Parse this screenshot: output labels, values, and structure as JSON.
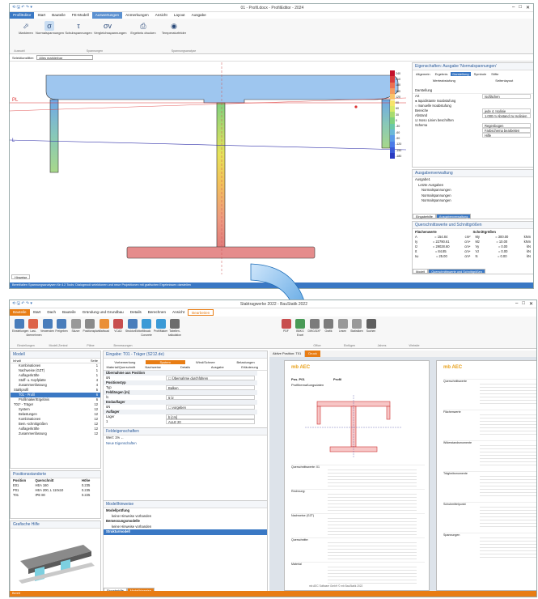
{
  "top": {
    "title": "01 - Profil.docx - ProfilEditor - 2024",
    "win": [
      "–",
      "□",
      "✕"
    ],
    "tabs": [
      "ProfilEditor",
      "Start",
      "Bauteile",
      "FE-Modell",
      "Auswertungen",
      "Anmerkungen",
      "Ansicht",
      "Layout",
      "Ausgabe"
    ],
    "active_tab": 4,
    "ribbon_buttons": [
      {
        "label": "Markieren",
        "icon": "cursor-icon",
        "glyph": "⬀"
      },
      {
        "label": "Normalspannungen",
        "icon": "sigma-icon",
        "glyph": "σ"
      },
      {
        "label": "Schubspannungen",
        "icon": "tau-icon",
        "glyph": "τ"
      },
      {
        "label": "Vergleichsspannungen",
        "icon": "sigma-v-icon",
        "glyph": "σv"
      },
      {
        "label": "Ergebnis drucken",
        "icon": "printer-icon",
        "glyph": "⎙"
      },
      {
        "label": "Temperaturfelder",
        "icon": "thermometer-icon",
        "glyph": "◉"
      }
    ],
    "groups": [
      "Auswahl",
      "Spannungen",
      "Spannungsanalyse"
    ],
    "filter_label": "Selektionsfilter:",
    "filter_value": "Alles markierbar",
    "labels": {
      "pl": "PL",
      "l": "L"
    },
    "legend": [
      "240",
      "210",
      "180",
      "150",
      "120",
      "90",
      "60",
      "30",
      "0",
      "-30",
      "-60",
      "-90",
      "-120",
      "-150",
      "-180"
    ],
    "bottom_tab": "Hinweise",
    "status": "Bereit/allen Spannungsanalysen für 4.2 Tools: Dialogmodi selektionen und neue Projektionen mit grafischen Ergebnissen darstellen",
    "props": {
      "title": "Eigenschaften: Ausgabe 'Normalspannungen'",
      "tabs": [
        "Allgemein",
        "Ergebnis",
        "Darstellung",
        "Symbole",
        "Stifte"
      ],
      "active_tab": 2,
      "subtabs": [
        "Werteabstufung",
        "Seitenlayout"
      ],
      "section": "Darstellung",
      "rows": [
        {
          "k": "Art",
          "v": "Isoflächen"
        },
        {
          "k": "● äquidistante Isoabstufung",
          "v": ""
        },
        {
          "k": "○ manuelle Isoabstufung",
          "v": ""
        },
        {
          "k": "Bereiche",
          "v": "jede 4. Isolinie"
        },
        {
          "k": "Abstand",
          "v": "1.000 m    Abstand zu Isolinien"
        },
        {
          "k": "☑ Isoso Linien beschriften",
          "v": ""
        },
        {
          "k": "Schema",
          "v": "Regenbogen"
        },
        {
          "k": "",
          "v": "Farbschema bearbeiten"
        },
        {
          "k": "",
          "v": "Hilfe"
        }
      ]
    },
    "outmgr": {
      "title": "Ausgabenverwaltung",
      "items": [
        "Ausgabe1",
        "Letzte Ausgaben",
        "Normalspannungen",
        "Normalspannungen",
        "Normalspannungen"
      ],
      "tabs": [
        "Eingabehilfe",
        "Ausgabenverwaltung"
      ]
    },
    "values": {
      "title": "Querschnittswerte und Schnittgrößen",
      "left_head": "Flächenwerte",
      "right_head": "Schnittgrößen",
      "left": [
        [
          "A",
          "= 154.84",
          "cm²"
        ],
        [
          "Iy",
          "= 22790.61",
          "cm⁴"
        ],
        [
          "Iz",
          "= 29028.60",
          "cm⁴"
        ],
        [
          "It",
          "= 84.85",
          "cm⁴"
        ],
        [
          "Iω",
          "= 25.00",
          "cm⁶"
        ]
      ],
      "right": [
        [
          "My",
          "= 300.00",
          "kNm"
        ],
        [
          "Mz",
          "= 10.00",
          "kNm"
        ],
        [
          "Vy",
          "= 0.00",
          "kN"
        ],
        [
          "Vz",
          "= 0.00",
          "kN"
        ],
        [
          "N",
          "= 0.00",
          "kN"
        ]
      ],
      "tabs": [
        "Modell",
        "Querschnittswerte und Schnittgrößen"
      ]
    }
  },
  "bottom": {
    "title": "Stabtragwerke 2022 - BauStatik 2022",
    "win": [
      "–",
      "□",
      "✕"
    ],
    "tabs": [
      "Bauteile",
      "Start",
      "Dach",
      "Bauteile",
      "Gründung und Grundbau",
      "Details",
      "Berechnen",
      "Ansicht",
      "Bearbeiten"
    ],
    "tab_hl": "Bearbeiten",
    "ribbon_buttons": [
      {
        "label": "Einstellungen",
        "icon": "ew-icon"
      },
      {
        "label": "Last-übernehmen",
        "icon": "load-icon"
      },
      {
        "label": "Verwenden",
        "icon": "use-icon"
      },
      {
        "label": "Freigeben",
        "icon": "share-icon"
      },
      {
        "label": "Skizze",
        "icon": "sketch-icon"
      },
      {
        "label": "Positionsplan",
        "icon": "plan-icon"
      },
      {
        "label": "Mathcad",
        "icon": "mathcad-icon"
      },
      {
        "label": "VCAD",
        "icon": "vcad-icon"
      },
      {
        "label": "StrukturEditor",
        "icon": "struct-icon"
      },
      {
        "label": "Mbcalc Concrete",
        "icon": "calc-icon"
      },
      {
        "label": "ProfilMaker",
        "icon": "profil-icon"
      },
      {
        "label": "Tabellen-kalkulation",
        "icon": "table-icon"
      },
      {
        "label": "PDF",
        "icon": "pdf-icon"
      },
      {
        "label": "BBKG Excel",
        "icon": "excel-icon"
      },
      {
        "label": "DWG/DXF",
        "icon": "dwg-icon"
      },
      {
        "label": "Grafik",
        "icon": "graphic-icon"
      },
      {
        "label": "Lesen",
        "icon": "read-icon"
      },
      {
        "label": "Statistiken",
        "icon": "stats-icon"
      },
      {
        "label": "Suchen",
        "icon": "binoculars-icon"
      }
    ],
    "groups": [
      "Einstellungen",
      "Modell-Zentral",
      "Pläne",
      "Bemessungen",
      "Office",
      "Einfügen",
      "Jahres",
      "Website"
    ],
    "model": {
      "title": "Modell",
      "cols": [
        "Inhalt",
        "Seite"
      ],
      "rows": [
        [
          "Kombinationen",
          "1"
        ],
        [
          "Nachweise (GZT)",
          "1"
        ],
        [
          "Auflagerkräfte",
          "1"
        ],
        [
          "Stoff- u. Kopfplatte",
          "4"
        ],
        [
          "Zusammenfassung",
          "4"
        ],
        [
          "Stahlprofil",
          "5"
        ],
        [
          "T01 - Profil",
          "6"
        ],
        [
          "Profilmaker/Ergebnis",
          "6"
        ],
        [
          "T01* - Träger",
          "12"
        ],
        [
          "System",
          "12"
        ],
        [
          "Belastungen",
          "12"
        ],
        [
          "Kombinationen",
          "12"
        ],
        [
          "Bem.-schnittgrößen",
          "12"
        ],
        [
          "Auflagerkräfte",
          "12"
        ],
        [
          "Zusammenfassung",
          "12"
        ]
      ]
    },
    "positions": {
      "title": "Positionsstandorte",
      "cols": [
        "Position",
        "Querschnitt",
        "Höhe"
      ],
      "rows": [
        [
          "E01",
          "HEA 160",
          "0.235"
        ],
        [
          "P01",
          "HEA 200, L 110x10",
          "0.235"
        ],
        [
          "T01",
          "IPE 80",
          "0.225"
        ]
      ]
    },
    "help": {
      "title": "Grafische Hilfe"
    },
    "input": {
      "title": "Eingabe: T01 - Träger (S212.de)",
      "tabs1": [
        "Vorbemerkung",
        "System",
        "Wind/Schnee",
        "Belastungen"
      ],
      "tabs2": [
        "Material/Querschnitt",
        "Nachweise",
        "Details",
        "Ausgabe",
        "Erläuterung"
      ],
      "active": "System",
      "rows": [
        {
          "k": "Übernahme aus Position",
          "v": ""
        },
        {
          "k": "üN",
          "v": "☐ Übernahme durchführen"
        },
        {
          "k": "Positionstyp",
          "v": ""
        },
        {
          "k": "Typ",
          "v": "Balken"
        },
        {
          "k": "Feldlängen [m]",
          "v": ""
        },
        {
          "k": "l1",
          "v": "5   l2"
        },
        {
          "k": "Endauflager",
          "v": ""
        },
        {
          "k": "üN",
          "v": "☐ vorgeben"
        },
        {
          "k": "Auflager",
          "v": ""
        },
        {
          "k": "Lager",
          "v": "b [cm]"
        },
        {
          "k": "1",
          "v": "ALLE   20"
        }
      ],
      "feld": {
        "title": "Feldeigenschaften",
        "l1": "Wert: 1% ←",
        "l2": "Neue Eigenschaften"
      }
    },
    "hints": {
      "title": "Modellhinweise",
      "items": [
        {
          "t": "Modellprüfung",
          "b": true
        },
        {
          "t": "keine Hinweise vorhanden",
          "b": false
        },
        {
          "t": "Bemessungsmodelle",
          "b": true
        },
        {
          "t": "keine Hinweise vorhanden",
          "b": false
        },
        {
          "t": "Strukturmodell",
          "b": true,
          "sel": true
        }
      ],
      "tabs": [
        "Eingabehilfe",
        "Modellhinweise"
      ]
    },
    "doc": {
      "tabs": [
        "Aktive Position: T01",
        "Druck"
      ],
      "logo": "mb AEC",
      "p1": {
        "pos": "Pos. P01",
        "kind": "Profil",
        "sub": "Profilbemaßungsdaten",
        "lines": [
          "Querschnittswerte: 01",
          "Rechnung:",
          "Nachweise (GZT)",
          "Querschnitte:",
          "Material"
        ],
        "footer": "mb AEC Software GmbH    © mb    BauStatik 2022"
      },
      "p2": {
        "lines": [
          "Querschnittswerte",
          "Flächenwerte",
          "Widerstandsmomente",
          "Trägheitsmomente",
          "Schubmittelpunkt",
          "Spannungen"
        ]
      }
    },
    "status_text": "Bereit"
  },
  "colors": {
    "accent": "#e87d14",
    "blue": "#3a78c4",
    "pl_line": "#d33333",
    "l_line": "#3344aa"
  }
}
